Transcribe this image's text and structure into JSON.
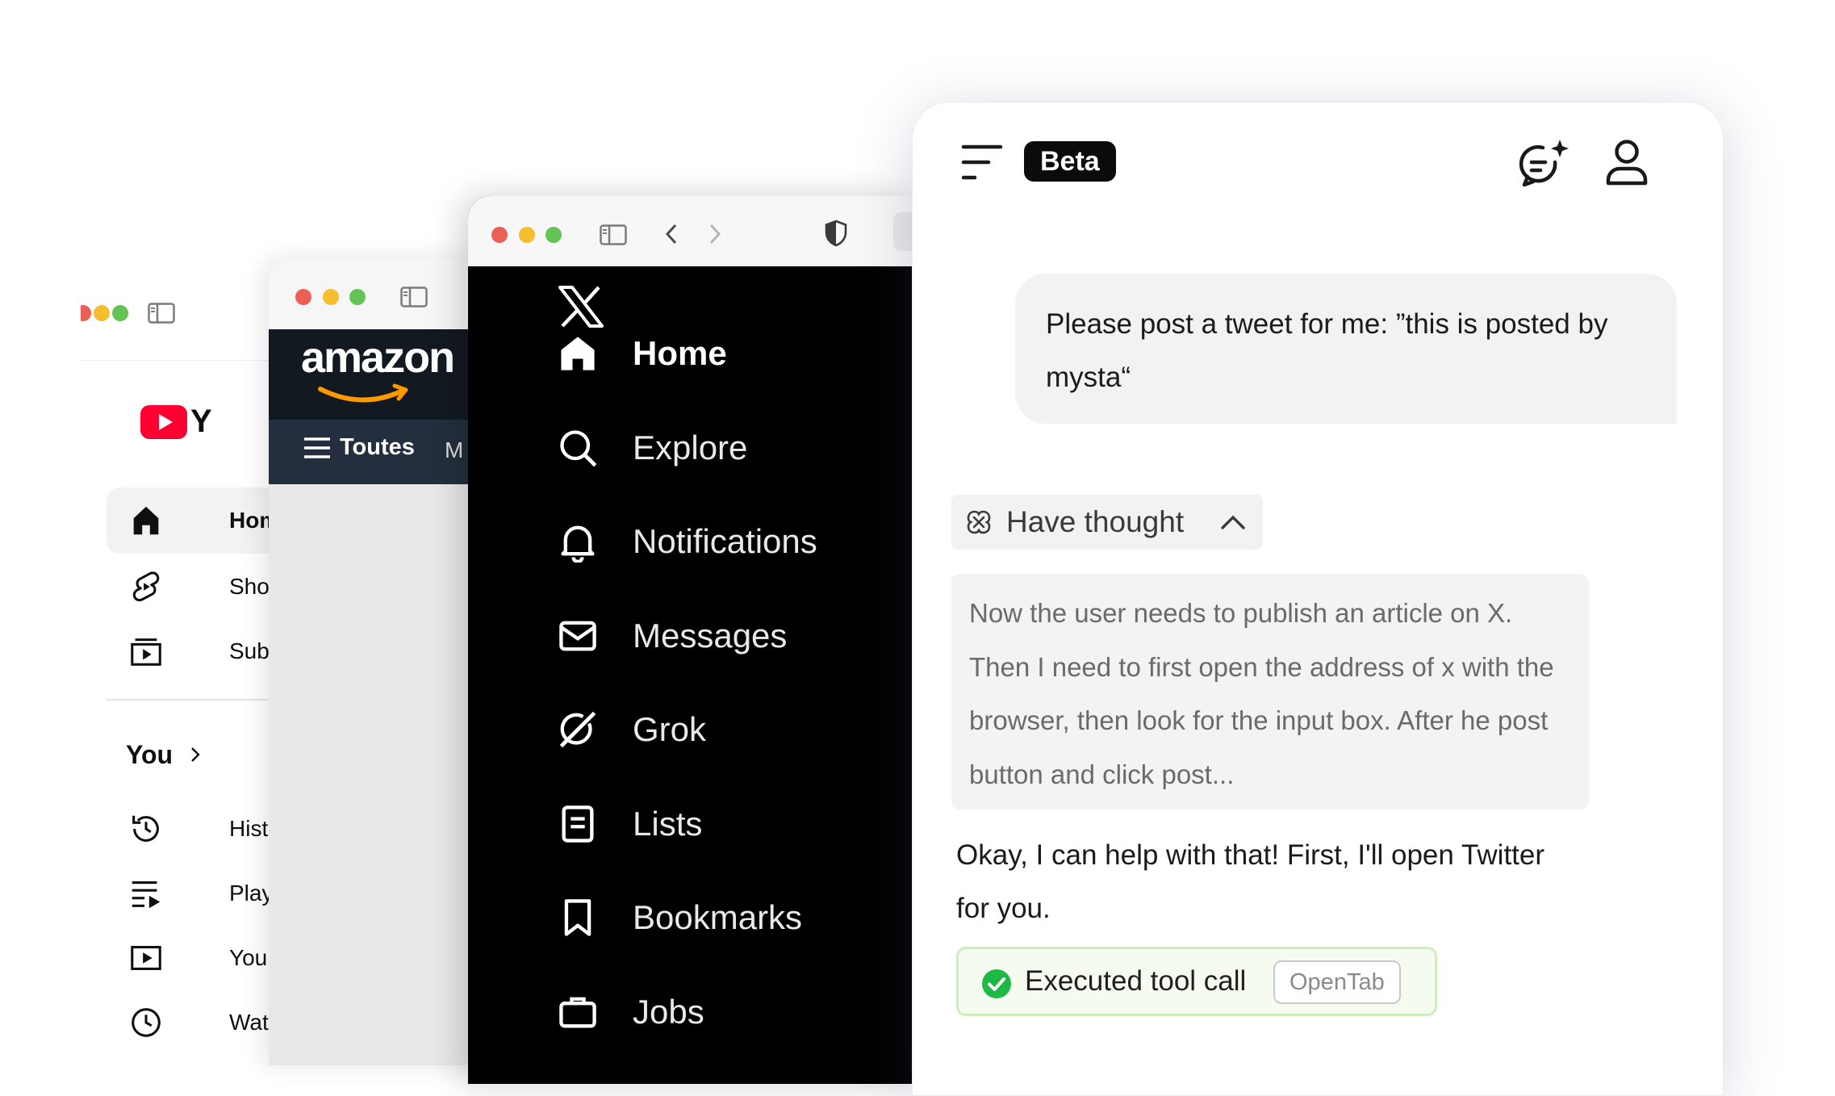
{
  "youtube": {
    "logo_letter": "Y",
    "nav": [
      {
        "label": "Home",
        "icon": "home-icon"
      },
      {
        "label": "Shorts",
        "icon": "shorts-icon"
      },
      {
        "label": "Subscriptions",
        "icon": "subscriptions-icon"
      }
    ],
    "you_label": "You",
    "you_items": [
      {
        "label": "History",
        "icon": "history-icon"
      },
      {
        "label": "Playlists",
        "icon": "playlists-icon"
      },
      {
        "label": "Your videos",
        "icon": "your-videos-icon"
      },
      {
        "label": "Watch later",
        "icon": "watch-later-icon"
      }
    ]
  },
  "amazon": {
    "logo": "amazon",
    "menu_label": "Toutes",
    "next_label": "M"
  },
  "x": {
    "nav": [
      {
        "label": "Home",
        "icon": "home-icon"
      },
      {
        "label": "Explore",
        "icon": "search-icon"
      },
      {
        "label": "Notifications",
        "icon": "bell-icon"
      },
      {
        "label": "Messages",
        "icon": "envelope-icon"
      },
      {
        "label": "Grok",
        "icon": "grok-icon"
      },
      {
        "label": "Lists",
        "icon": "list-icon"
      },
      {
        "label": "Bookmarks",
        "icon": "bookmark-icon"
      },
      {
        "label": "Jobs",
        "icon": "briefcase-icon"
      }
    ]
  },
  "mysta": {
    "badge": "Beta",
    "user_message": "Please post a tweet for me: ”this is posted by mysta“",
    "thought_label": "Have thought",
    "thought_text": "Now the user needs to publish an article on X. Then I need to first open the address of x with the browser, then look for the input box. After he post button and click post...",
    "reply_text": "Okay, I can help with that! First, I'll open Twitter for you.",
    "tool_call_label": "Executed tool call",
    "tool_name": "OpenTab"
  },
  "colors": {
    "x_background": "#000000",
    "amazon_header": "#131921",
    "amazon_orange": "#ff9900",
    "youtube_red": "#ff0033",
    "success_green": "#1eb845"
  }
}
